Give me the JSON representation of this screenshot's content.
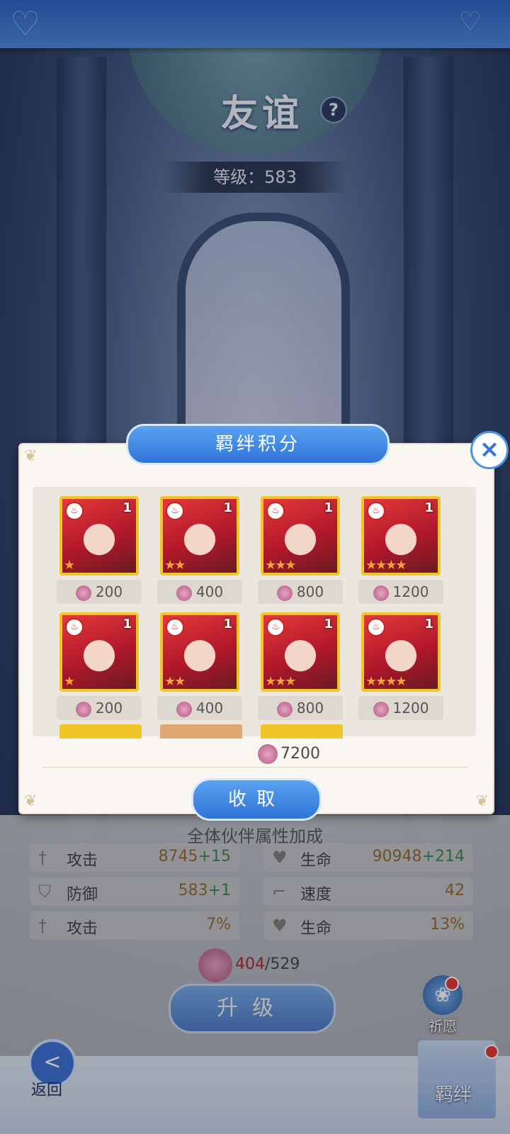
{
  "header": {
    "title": "友谊",
    "level_text": "等级：583"
  },
  "attributes": {
    "title": "全体伙伴属性加成",
    "rows": [
      {
        "label": "攻击",
        "base": "8745",
        "bonus": "+15"
      },
      {
        "label": "生命",
        "base": "90948",
        "bonus": "+214"
      },
      {
        "label": "防御",
        "base": "583",
        "bonus": "+1"
      },
      {
        "label": "速度",
        "base": "42",
        "bonus": ""
      },
      {
        "label": "攻击",
        "base": "7%",
        "bonus": ""
      },
      {
        "label": "生命",
        "base": "13%",
        "bonus": ""
      }
    ]
  },
  "points": {
    "current": "404",
    "total": "/529"
  },
  "buttons": {
    "upgrade": "升级",
    "wish": "祈愿",
    "back": "返回",
    "bond": "羁绊"
  },
  "dialog": {
    "title": "羁绊积分",
    "cards": [
      {
        "level": "1",
        "stars": "★",
        "cost": "200"
      },
      {
        "level": "1",
        "stars": "★★",
        "cost": "400"
      },
      {
        "level": "1",
        "stars": "★★★",
        "cost": "800"
      },
      {
        "level": "1",
        "stars": "★★★★",
        "cost": "1200"
      },
      {
        "level": "1",
        "stars": "★",
        "cost": "200"
      },
      {
        "level": "1",
        "stars": "★★",
        "cost": "400"
      },
      {
        "level": "1",
        "stars": "★★★",
        "cost": "800"
      },
      {
        "level": "1",
        "stars": "★★★★",
        "cost": "1200"
      }
    ],
    "total": "7200",
    "collect": "收取"
  }
}
